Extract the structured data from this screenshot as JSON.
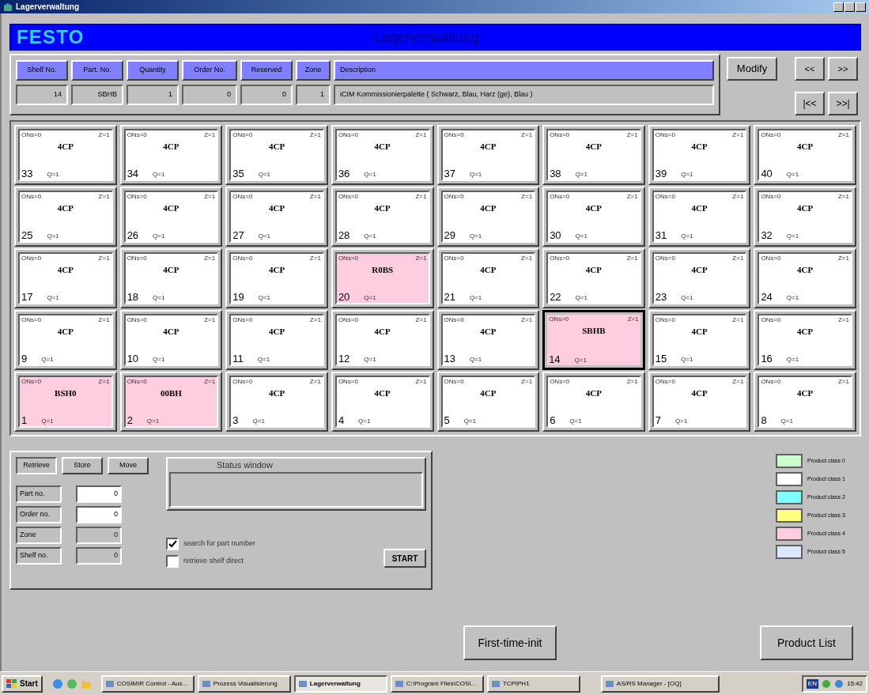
{
  "window": {
    "title": "Lagerverwaltung"
  },
  "banner": {
    "logo": "FESTO",
    "title": "Lagerverwaltung"
  },
  "record": [
    {
      "label": "Shelf No.",
      "value": "14"
    },
    {
      "label": "Part. No.",
      "value": "SBHB"
    },
    {
      "label": "Quantity",
      "value": "1"
    },
    {
      "label": "Order No.",
      "value": "0"
    },
    {
      "label": "Reserved",
      "value": "0"
    },
    {
      "label": "Zone",
      "value": "1"
    },
    {
      "label": "Description",
      "value": "iCIM Kommissionierpalette ( Schwarz, Blau, Harz (ge), Blau )"
    }
  ],
  "modify_button": "Modify",
  "nav_buttons": [
    [
      "<<",
      ">>"
    ],
    [
      "|<<",
      ">>|"
    ]
  ],
  "shelf_rows": [
    [
      {
        "shelf": "33",
        "part": "4CP",
        "ons": "ONs=0",
        "zone": "Z=1",
        "qty": "Q=1",
        "color": "#ffffff",
        "selected": false
      },
      {
        "shelf": "34",
        "part": "4CP",
        "ons": "ONs=0",
        "zone": "Z=1",
        "qty": "Q=1",
        "color": "#ffffff",
        "selected": false
      },
      {
        "shelf": "35",
        "part": "4CP",
        "ons": "ONs=0",
        "zone": "Z=1",
        "qty": "Q=1",
        "color": "#ffffff",
        "selected": false
      },
      {
        "shelf": "36",
        "part": "4CP",
        "ons": "ONs=0",
        "zone": "Z=1",
        "qty": "Q=1",
        "color": "#ffffff",
        "selected": false
      },
      {
        "shelf": "37",
        "part": "4CP",
        "ons": "ONs=0",
        "zone": "Z=1",
        "qty": "Q=1",
        "color": "#ffffff",
        "selected": false
      },
      {
        "shelf": "38",
        "part": "4CP",
        "ons": "ONs=0",
        "zone": "Z=1",
        "qty": "Q=1",
        "color": "#ffffff",
        "selected": false
      },
      {
        "shelf": "39",
        "part": "4CP",
        "ons": "ONs=0",
        "zone": "Z=1",
        "qty": "Q=1",
        "color": "#ffffff",
        "selected": false
      },
      {
        "shelf": "40",
        "part": "4CP",
        "ons": "ONs=0",
        "zone": "Z=1",
        "qty": "Q=1",
        "color": "#ffffff",
        "selected": false
      }
    ],
    [
      {
        "shelf": "25",
        "part": "4CP",
        "ons": "ONs=0",
        "zone": "Z=1",
        "qty": "Q=1",
        "color": "#ffffff",
        "selected": false
      },
      {
        "shelf": "26",
        "part": "4CP",
        "ons": "ONs=0",
        "zone": "Z=1",
        "qty": "Q=1",
        "color": "#ffffff",
        "selected": false
      },
      {
        "shelf": "27",
        "part": "4CP",
        "ons": "ONs=0",
        "zone": "Z=1",
        "qty": "Q=1",
        "color": "#ffffff",
        "selected": false
      },
      {
        "shelf": "28",
        "part": "4CP",
        "ons": "ONs=0",
        "zone": "Z=1",
        "qty": "Q=1",
        "color": "#ffffff",
        "selected": false
      },
      {
        "shelf": "29",
        "part": "4CP",
        "ons": "ONs=0",
        "zone": "Z=1",
        "qty": "Q=1",
        "color": "#ffffff",
        "selected": false
      },
      {
        "shelf": "30",
        "part": "4CP",
        "ons": "ONs=0",
        "zone": "Z=1",
        "qty": "Q=1",
        "color": "#ffffff",
        "selected": false
      },
      {
        "shelf": "31",
        "part": "4CP",
        "ons": "ONs=0",
        "zone": "Z=1",
        "qty": "Q=1",
        "color": "#ffffff",
        "selected": false
      },
      {
        "shelf": "32",
        "part": "4CP",
        "ons": "ONs=0",
        "zone": "Z=1",
        "qty": "Q=1",
        "color": "#ffffff",
        "selected": false
      }
    ],
    [
      {
        "shelf": "17",
        "part": "4CP",
        "ons": "ONs=0",
        "zone": "Z=1",
        "qty": "Q=1",
        "color": "#ffffff",
        "selected": false
      },
      {
        "shelf": "18",
        "part": "4CP",
        "ons": "ONs=0",
        "zone": "Z=1",
        "qty": "Q=1",
        "color": "#ffffff",
        "selected": false
      },
      {
        "shelf": "19",
        "part": "4CP",
        "ons": "ONs=0",
        "zone": "Z=1",
        "qty": "Q=1",
        "color": "#ffffff",
        "selected": false
      },
      {
        "shelf": "20",
        "part": "R0BS",
        "ons": "ONs=0",
        "zone": "Z=1",
        "qty": "Q=1",
        "color": "#ffcce0",
        "selected": false
      },
      {
        "shelf": "21",
        "part": "4CP",
        "ons": "ONs=0",
        "zone": "Z=1",
        "qty": "Q=1",
        "color": "#ffffff",
        "selected": false
      },
      {
        "shelf": "22",
        "part": "4CP",
        "ons": "ONs=0",
        "zone": "Z=1",
        "qty": "Q=1",
        "color": "#ffffff",
        "selected": false
      },
      {
        "shelf": "23",
        "part": "4CP",
        "ons": "ONs=0",
        "zone": "Z=1",
        "qty": "Q=1",
        "color": "#ffffff",
        "selected": false
      },
      {
        "shelf": "24",
        "part": "4CP",
        "ons": "ONs=0",
        "zone": "Z=1",
        "qty": "Q=1",
        "color": "#ffffff",
        "selected": false
      }
    ],
    [
      {
        "shelf": "9",
        "part": "4CP",
        "ons": "ONs=0",
        "zone": "Z=1",
        "qty": "Q=1",
        "color": "#ffffff",
        "selected": false
      },
      {
        "shelf": "10",
        "part": "4CP",
        "ons": "ONs=0",
        "zone": "Z=1",
        "qty": "Q=1",
        "color": "#ffffff",
        "selected": false
      },
      {
        "shelf": "11",
        "part": "4CP",
        "ons": "ONs=0",
        "zone": "Z=1",
        "qty": "Q=1",
        "color": "#ffffff",
        "selected": false
      },
      {
        "shelf": "12",
        "part": "4CP",
        "ons": "ONs=0",
        "zone": "Z=1",
        "qty": "Q=1",
        "color": "#ffffff",
        "selected": false
      },
      {
        "shelf": "13",
        "part": "4CP",
        "ons": "ONs=0",
        "zone": "Z=1",
        "qty": "Q=1",
        "color": "#ffffff",
        "selected": false
      },
      {
        "shelf": "14",
        "part": "SBHB",
        "ons": "ONs=0",
        "zone": "Z=1",
        "qty": "Q=1",
        "color": "#ffcce0",
        "selected": true
      },
      {
        "shelf": "15",
        "part": "4CP",
        "ons": "ONs=0",
        "zone": "Z=1",
        "qty": "Q=1",
        "color": "#ffffff",
        "selected": false
      },
      {
        "shelf": "16",
        "part": "4CP",
        "ons": "ONs=0",
        "zone": "Z=1",
        "qty": "Q=1",
        "color": "#ffffff",
        "selected": false
      }
    ],
    [
      {
        "shelf": "1",
        "part": "BSH0",
        "ons": "ONs=0",
        "zone": "Z=1",
        "qty": "Q=1",
        "color": "#ffcce0",
        "selected": false
      },
      {
        "shelf": "2",
        "part": "00BH",
        "ons": "ONs=0",
        "zone": "Z=1",
        "qty": "Q=1",
        "color": "#ffcce0",
        "selected": false
      },
      {
        "shelf": "3",
        "part": "4CP",
        "ons": "ONs=0",
        "zone": "Z=1",
        "qty": "Q=1",
        "color": "#ffffff",
        "selected": false
      },
      {
        "shelf": "4",
        "part": "4CP",
        "ons": "ONs=0",
        "zone": "Z=1",
        "qty": "Q=1",
        "color": "#ffffff",
        "selected": false
      },
      {
        "shelf": "5",
        "part": "4CP",
        "ons": "ONs=0",
        "zone": "Z=1",
        "qty": "Q=1",
        "color": "#ffffff",
        "selected": false
      },
      {
        "shelf": "6",
        "part": "4CP",
        "ons": "ONs=0",
        "zone": "Z=1",
        "qty": "Q=1",
        "color": "#ffffff",
        "selected": false
      },
      {
        "shelf": "7",
        "part": "4CP",
        "ons": "ONs=0",
        "zone": "Z=1",
        "qty": "Q=1",
        "color": "#ffffff",
        "selected": false
      },
      {
        "shelf": "8",
        "part": "4CP",
        "ons": "ONs=0",
        "zone": "Z=1",
        "qty": "Q=1",
        "color": "#ffffff",
        "selected": false
      }
    ]
  ],
  "operation": {
    "tabs": [
      {
        "label": "Retrieve",
        "selected": true
      },
      {
        "label": "Store",
        "selected": false
      },
      {
        "label": "Move",
        "selected": false
      }
    ],
    "fields": [
      {
        "label": "Part no.",
        "value": "0",
        "disabled": false
      },
      {
        "label": "Order no.",
        "value": "0",
        "disabled": false
      },
      {
        "label": "Zone",
        "value": "0",
        "disabled": true
      },
      {
        "label": "Shelf no.",
        "value": "0",
        "disabled": true
      }
    ],
    "status_window": {
      "title": "Status window"
    },
    "checkboxes": [
      {
        "label": "search for part number",
        "checked": true
      },
      {
        "label": "retrieve shelf direct",
        "checked": false
      }
    ],
    "start_button": "START"
  },
  "legend": [
    {
      "label": "Product class 0",
      "color": "#ccffcc"
    },
    {
      "label": "Product class 1",
      "color": "#ffffff"
    },
    {
      "label": "Product class 2",
      "color": "#80ffff"
    },
    {
      "label": "Product class 3",
      "color": "#ffff80"
    },
    {
      "label": "Product class 4",
      "color": "#ffcce0"
    },
    {
      "label": "Product class 5",
      "color": "#dde6ff"
    }
  ],
  "buttons": [
    "First-time-init",
    "Product List"
  ],
  "taskbar": {
    "start": "Start",
    "tasks": [
      {
        "label": "COSIMIR Control - Aus...",
        "selected": false
      },
      {
        "label": "Prozess Visualisierung",
        "selected": false
      },
      {
        "label": "Lagerverwaltung",
        "selected": true
      },
      {
        "label": "C:\\Program Files\\COSI...",
        "selected": false
      },
      {
        "label": "TCPIPH1",
        "selected": false
      },
      {
        "label": "AS/RS Manager - [OQ]",
        "selected": false
      }
    ],
    "language": "EN",
    "clock": "15:42"
  }
}
